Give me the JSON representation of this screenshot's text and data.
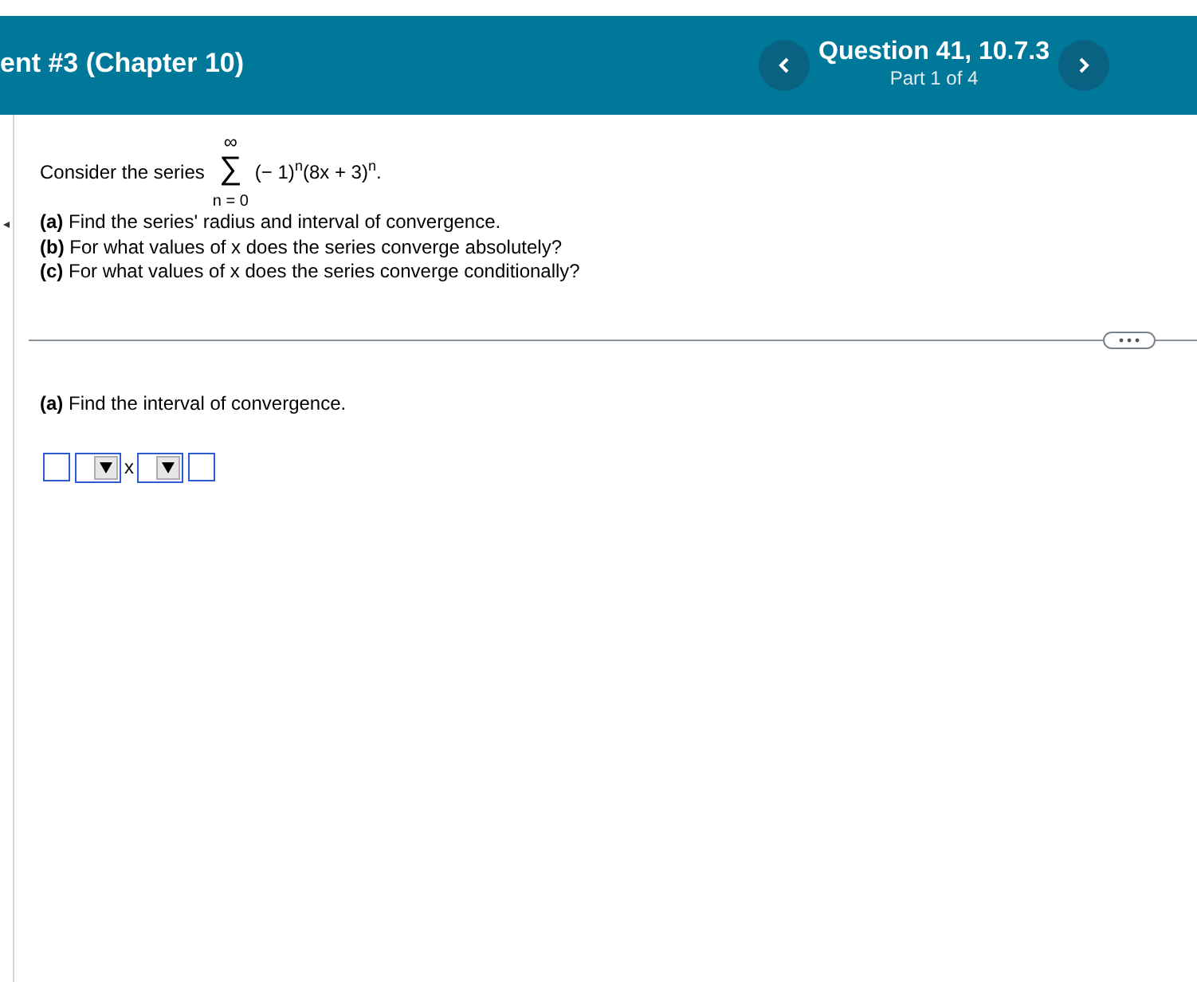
{
  "header": {
    "title": "ent #3 (Chapter 10)",
    "question": "Question 41, 10.7.3",
    "part": "Part 1 of 4"
  },
  "problem": {
    "intro": "Consider the series",
    "sum": {
      "upper": "∞",
      "symbol": "∑",
      "lower": "n = 0"
    },
    "term": "(− 1)$^{n}$(8x + 3)$^{n}$.",
    "parts": [
      "**(a)** Find the series' radius and interval of convergence.",
      "**(b)** For what values of x does the series converge absolutely?",
      "**(c)** For what values of x does the series converge conditionally?"
    ]
  },
  "answer": {
    "prompt": "**(a)** Find the interval of convergence.",
    "items": [
      {
        "kind": "box"
      },
      {
        "kind": "dropdown"
      },
      {
        "kind": "text",
        "text": "x"
      },
      {
        "kind": "dropdown"
      },
      {
        "kind": "box"
      }
    ]
  }
}
